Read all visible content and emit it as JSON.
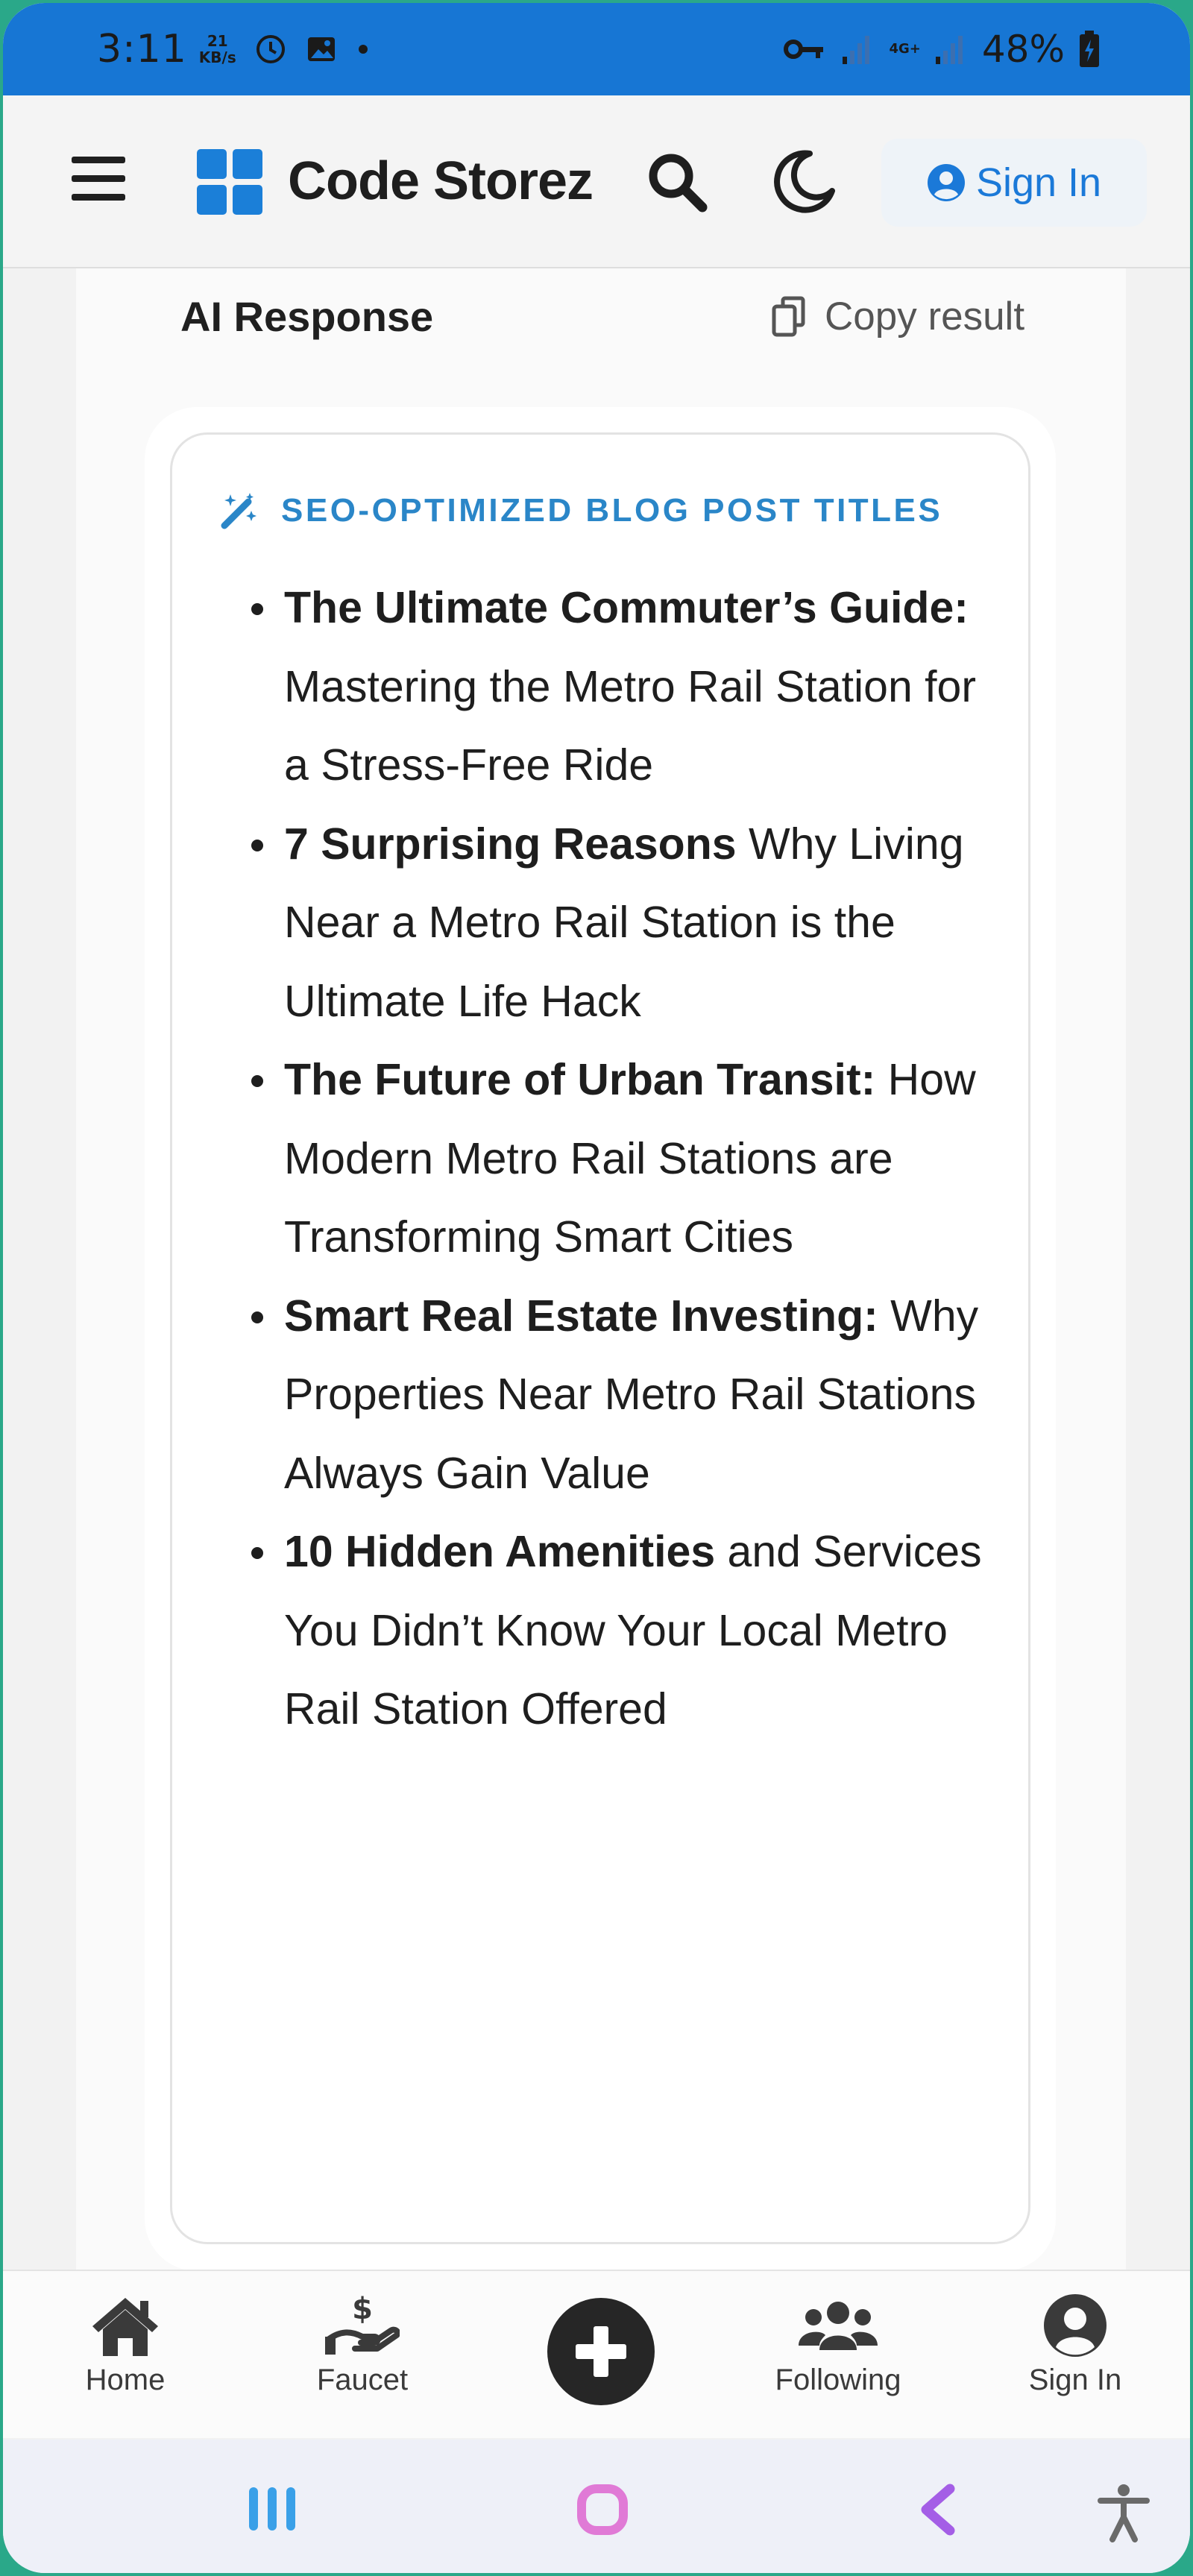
{
  "status_bar": {
    "time": "3:11",
    "speed_value": "21",
    "speed_unit": "KB/s",
    "network": "4G+",
    "battery": "48%"
  },
  "header": {
    "brand": "Code Storez",
    "sign_in": "Sign In"
  },
  "response": {
    "title": "AI Response",
    "copy_label": "Copy result",
    "section_title": "SEO-OPTIMIZED BLOG POST TITLES",
    "items": [
      {
        "bold": "The Ultimate Commuter’s Guide:",
        "rest": " Mastering the Metro Rail Station for a Stress-Free Ride"
      },
      {
        "bold": "7 Surprising Reasons",
        "rest": " Why Living Near a Metro Rail Station is the Ultimate Life Hack"
      },
      {
        "bold": "The Future of Urban Transit:",
        "rest": " How Modern Metro Rail Stations are Transforming Smart Cities"
      },
      {
        "bold": "Smart Real Estate Investing:",
        "rest": " Why Properties Near Metro Rail Stations Always Gain Value"
      },
      {
        "bold": "10 Hidden Amenities",
        "rest": " and Services You Didn’t Know Your Local Metro Rail Station Offered"
      }
    ]
  },
  "bottom_nav": {
    "home": "Home",
    "faucet": "Faucet",
    "following": "Following",
    "sign_in": "Sign In"
  },
  "colors": {
    "accent": "#1b79d8",
    "section_title": "#2a86c8",
    "status_bar": "#1776d4",
    "recents": "#3aa0e8",
    "home": "#e07ad6",
    "back": "#a45ee6"
  },
  "icons": {
    "menu": "hamburger-icon",
    "search": "search-icon",
    "theme": "moon-icon",
    "copy": "copy-icon",
    "section": "magic-wand-icon",
    "add": "plus-icon"
  }
}
